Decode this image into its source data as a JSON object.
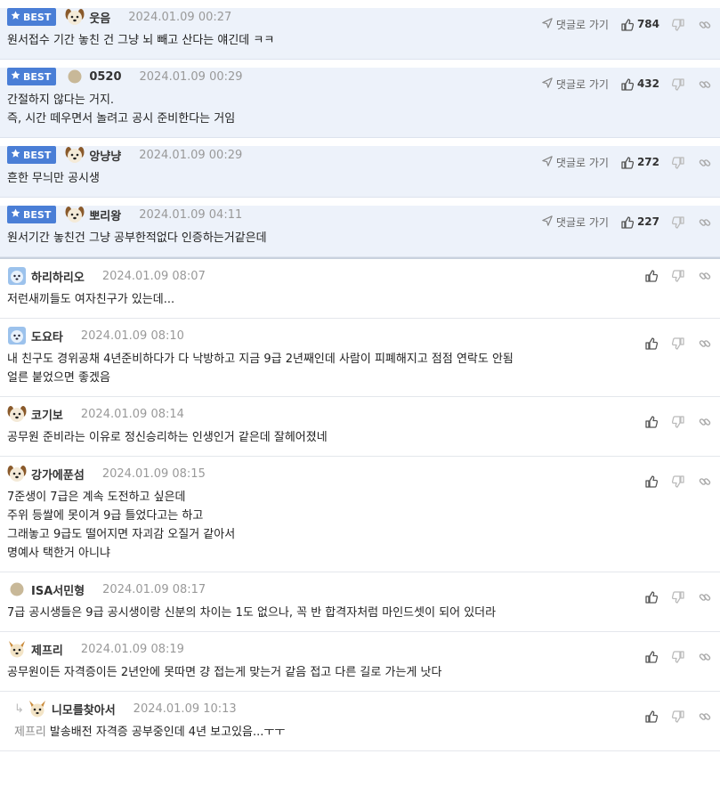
{
  "labels": {
    "best_badge": "BEST",
    "reply_link": "댓글로 가기"
  },
  "comments": [
    {
      "best": true,
      "avatar": "dog-avatar",
      "nick": "웃음",
      "date": "2024.01.09 00:27",
      "likes": "784",
      "lines": [
        "원서접수 기간 놓친 건 그냥 뇌 빼고 산다는 얘긴데 ㅋㅋ"
      ]
    },
    {
      "best": true,
      "avatar": "circle-avatar",
      "nick": "0520",
      "date": "2024.01.09 00:29",
      "likes": "432",
      "lines": [
        "간절하지 않다는 거지.",
        "즉, 시간 떼우면서 놀려고 공시 준비한다는 거임"
      ]
    },
    {
      "best": true,
      "avatar": "dog-avatar",
      "nick": "앙냥냥",
      "date": "2024.01.09 00:29",
      "likes": "272",
      "lines": [
        "흔한 무늬만 공시생"
      ]
    },
    {
      "best": true,
      "avatar": "dog-avatar",
      "nick": "뽀리왕",
      "date": "2024.01.09 04:11",
      "likes": "227",
      "lines": [
        "원서기간 놓친건 그냥 공부한적없다 인증하는거같은데"
      ]
    },
    {
      "best": false,
      "avatar": "blue-dog-avatar",
      "nick": "하리하리오",
      "date": "2024.01.09 08:07",
      "lines": [
        "저런새끼들도 여자친구가 있는데..."
      ]
    },
    {
      "best": false,
      "avatar": "blue-dog-avatar",
      "nick": "도요타",
      "date": "2024.01.09 08:10",
      "lines": [
        "내 친구도 경위공채 4년준비하다가 다 낙방하고 지금 9급 2년째인데 사람이 피폐해지고 점점 연락도 안됨",
        "얼른 붙었으면 좋겠음"
      ]
    },
    {
      "best": false,
      "avatar": "dog-avatar",
      "nick": "코기보",
      "date": "2024.01.09 08:14",
      "lines": [
        "공무원 준비라는 이유로 정신승리하는 인생인거 같은데 잘헤어졌네"
      ]
    },
    {
      "best": false,
      "avatar": "dog-avatar",
      "nick": "강가에푼섬",
      "date": "2024.01.09 08:15",
      "lines": [
        "7준생이 7급은 계속 도전하고 싶은데",
        "주위 등쌀에 못이겨 9급 틀었다고는 하고",
        "그래놓고 9급도 떨어지면 자괴감 오질거 같아서",
        "명예사 택한거 아니냐"
      ]
    },
    {
      "best": false,
      "avatar": "circle-avatar",
      "nick": "ISA서민형",
      "date": "2024.01.09 08:17",
      "lines": [
        "7급 공시생들은 9급 공시생이랑 신분의 차이는 1도 없으나, 꼭 반 합격자처럼 마인드셋이 되어 있더라"
      ]
    },
    {
      "best": false,
      "avatar": "fox-avatar",
      "nick": "제프리",
      "date": "2024.01.09 08:19",
      "lines": [
        "공무원이든 자격증이든 2년안에 못따면 걍 접는게 맞는거 같음 접고 다른 길로 가는게 낫다"
      ]
    },
    {
      "best": false,
      "reply": true,
      "avatar": "fox-avatar",
      "nick": "니모를찾아서",
      "date": "2024.01.09 10:13",
      "mention": "제프리",
      "lines": [
        "발송배전 자격증 공부중인데 4년 보고있음...ㅜㅜ"
      ]
    }
  ],
  "colors": {
    "best_bg": "#edf2fa",
    "badge": "#4a7ed6"
  }
}
